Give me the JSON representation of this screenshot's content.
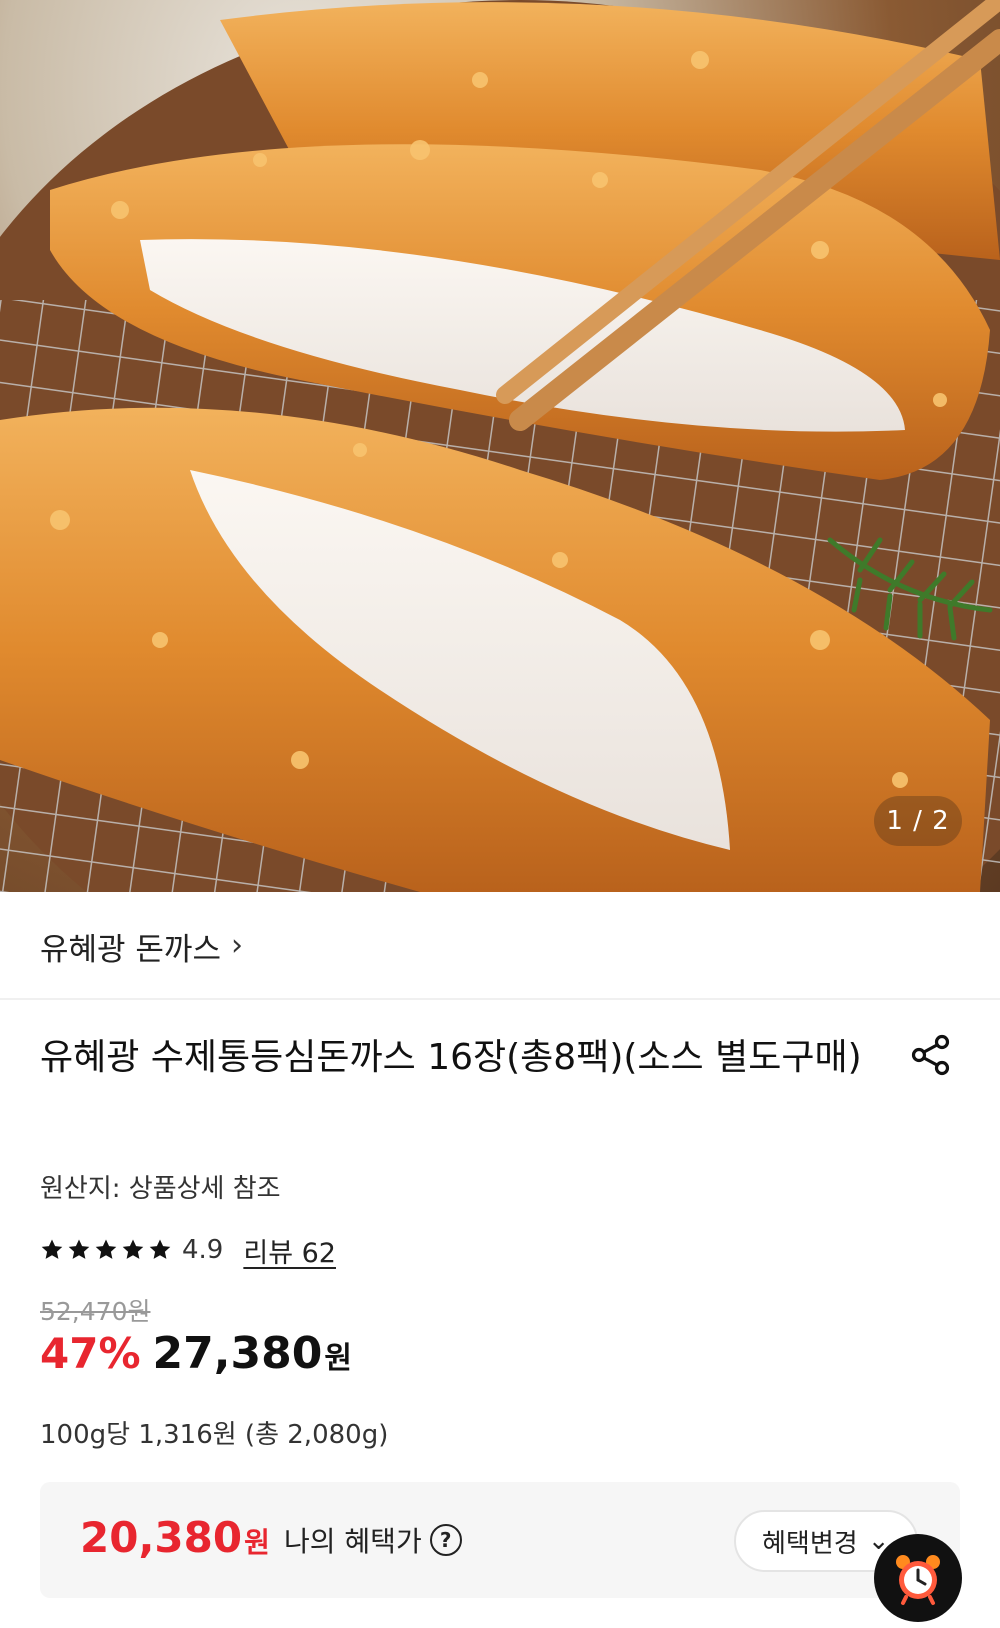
{
  "hero": {
    "image_alt": "",
    "counter": "1 / 2"
  },
  "brand": {
    "name": "유혜광 돈까스",
    "chevron": "›"
  },
  "product": {
    "title": "유혜광 수제통등심돈까스 16장(총8팩)(소스 별도구매)",
    "origin": "원산지: 상품상세 참조",
    "rating": "4.9",
    "stars": 5,
    "review_link": "리뷰 62",
    "original_price": "52,470원",
    "discount": "47%",
    "sale_price": "27,380",
    "sale_currency": "원",
    "unit_price": "100g당 1,316원 (총 2,080g)"
  },
  "benefit": {
    "amount": "20,380",
    "currency": "원",
    "label": "나의 혜택가",
    "help": "?",
    "change_button": "혜택변경",
    "change_chevron": "⌄"
  },
  "colors": {
    "accent_red": "#e8262f",
    "benefit_bg": "#f6f6f6"
  },
  "icons": {
    "share": "share-icon",
    "star": "star-icon",
    "help": "help-circle-icon",
    "alarm": "alarm-clock-icon"
  }
}
